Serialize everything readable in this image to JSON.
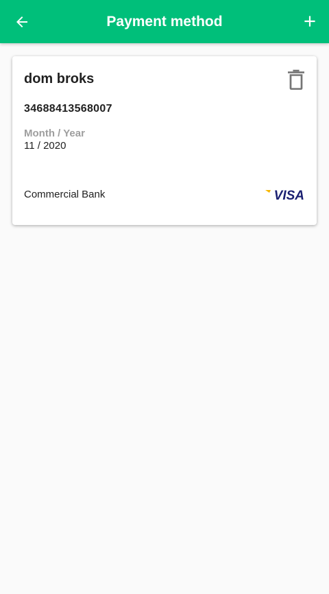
{
  "header": {
    "title": "Payment method",
    "back_icon": "arrow-left-icon",
    "add_icon": "plus-icon",
    "background_color": "#00bf7a"
  },
  "cards": [
    {
      "holder_name": "dom broks",
      "number": "34688413568007",
      "expiry_label": "Month / Year",
      "expiry_value": "11 / 2020",
      "bank": "Commercial Bank",
      "brand": "VISA",
      "delete_icon": "trash-icon"
    }
  ]
}
